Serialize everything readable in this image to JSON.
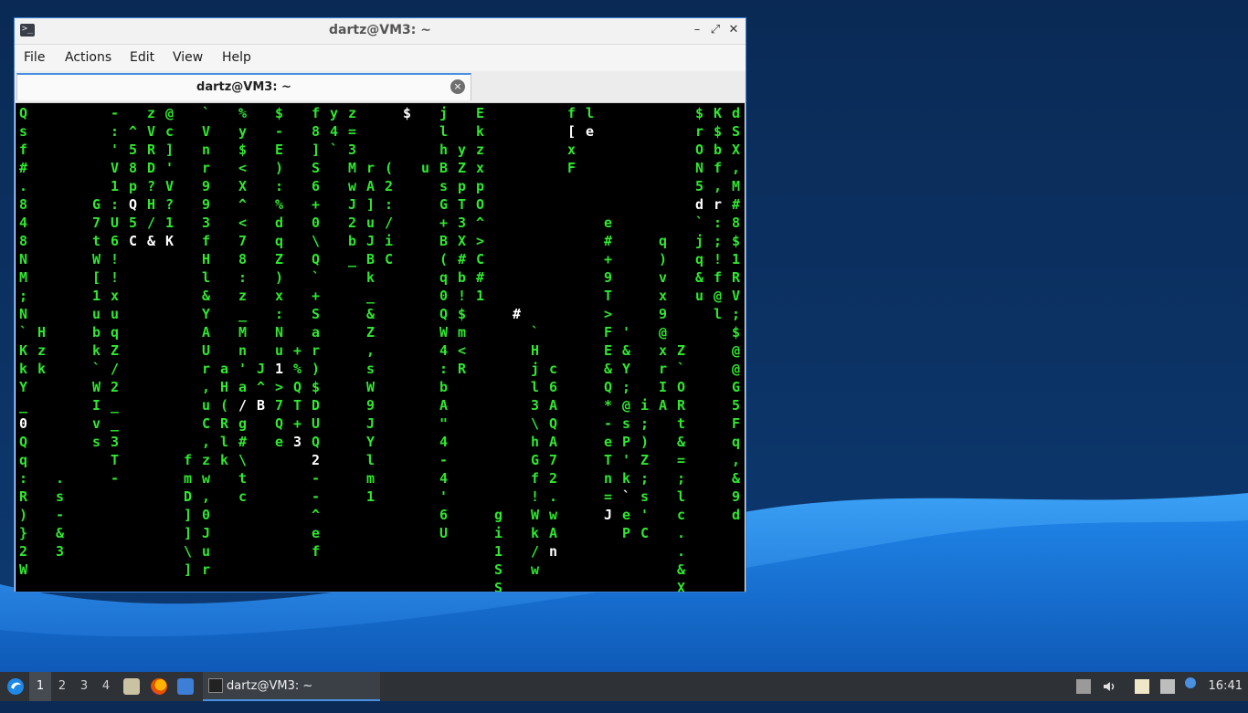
{
  "window": {
    "title": "dartz@VM3: ~",
    "minimize_glyph": "–",
    "maximize_glyph": "⤢",
    "close_glyph": "✕"
  },
  "menu": {
    "file": "File",
    "actions": "Actions",
    "edit": "Edit",
    "view": "View",
    "help": "Help"
  },
  "tab": {
    "label": "dartz@VM3: ~",
    "close_glyph": "×"
  },
  "terminal": {
    "colors": {
      "green": "#2fe82f",
      "white": "#ffffff",
      "background": "#000000"
    },
    "columns": [
      {
        "c": 0,
        "r0": 0,
        "chars": "Qsf#.848NM;N`KkY_0Qq:R)}2W",
        "hi": [
          17
        ]
      },
      {
        "c": 1,
        "r0": 12,
        "chars": "Hzk",
        "hi": []
      },
      {
        "c": 2,
        "r0": 20,
        "chars": ".s-&3",
        "hi": []
      },
      {
        "c": 4,
        "r0": 5,
        "chars": "G7tW[1ubk`WIvs",
        "hi": [
          24
        ]
      },
      {
        "c": 5,
        "r0": 0,
        "chars": "-:'V1:U6!!xuqZ/2__3T-",
        "hi": []
      },
      {
        "c": 6,
        "r0": 1,
        "chars": "^58pQ5C",
        "hi": [
          5,
          7
        ]
      },
      {
        "c": 7,
        "r0": 0,
        "chars": "zVRD?H/&",
        "hi": [
          7,
          14
        ]
      },
      {
        "c": 8,
        "r0": 0,
        "chars": "@c]'V?1K",
        "hi": [
          7
        ]
      },
      {
        "c": 9,
        "r0": 19,
        "chars": "fmD]]\\]",
        "hi": []
      },
      {
        "c": 10,
        "r0": 0,
        "chars": "`Vnr993fHl&YAUr,uC,zw,0Jur",
        "hi": []
      },
      {
        "c": 11,
        "r0": 14,
        "chars": "aH(Rlk",
        "hi": [
          20
        ]
      },
      {
        "c": 12,
        "r0": 0,
        "chars": "%y$<X^<78:z_Mn'a/g#\\tc",
        "hi": [
          16
        ]
      },
      {
        "c": 13,
        "r0": 14,
        "chars": "J^B",
        "hi": [
          16
        ]
      },
      {
        "c": 14,
        "r0": 0,
        "chars": "$-E):%dqZ)x:Nu1>7Qe",
        "hi": [
          14
        ]
      },
      {
        "c": 15,
        "r0": 13,
        "chars": "+%QT+3",
        "hi": [
          18
        ]
      },
      {
        "c": 16,
        "r0": 0,
        "chars": "f8]S6+0\\Q`+Sar)$DUQ2--^ef",
        "hi": [
          19,
          30
        ]
      },
      {
        "c": 17,
        "r0": 0,
        "chars": "y4`",
        "hi": []
      },
      {
        "c": 18,
        "r0": 0,
        "chars": "z=3MwJ2b_",
        "hi": [
          11,
          16
        ]
      },
      {
        "c": 19,
        "r0": 3,
        "chars": "rA]uJBk_&Z,sW9JYlm1",
        "hi": []
      },
      {
        "c": 20,
        "r0": 3,
        "chars": "(2:/iC",
        "hi": [
          20
        ]
      },
      {
        "c": 21,
        "r0": 0,
        "chars": "$",
        "hi": [
          0
        ]
      },
      {
        "c": 22,
        "r0": 3,
        "chars": "u",
        "hi": []
      },
      {
        "c": 23,
        "r0": 0,
        "chars": "jlhBsG+B(q0QW4:bA\"4-4'6U",
        "hi": []
      },
      {
        "c": 24,
        "r0": 2,
        "chars": "yZpT3X#b!$m<R",
        "hi": [
          15
        ]
      },
      {
        "c": 25,
        "r0": 0,
        "chars": "EkzxpO^>C#1",
        "hi": []
      },
      {
        "c": 26,
        "r0": 22,
        "chars": "gi1SSe)",
        "hi": [
          15
        ]
      },
      {
        "c": 27,
        "r0": 11,
        "chars": "#",
        "hi": [
          11
        ]
      },
      {
        "c": 28,
        "r0": 12,
        "chars": "`Hjl3\\hGf!Wk/w",
        "hi": []
      },
      {
        "c": 29,
        "r0": 14,
        "chars": "c6AQA72.wAn",
        "hi": [
          24
        ]
      },
      {
        "c": 30,
        "r0": 0,
        "chars": "f[xF",
        "hi": [
          1
        ]
      },
      {
        "c": 31,
        "r0": 0,
        "chars": "le",
        "hi": [
          1
        ]
      },
      {
        "c": 32,
        "r0": 6,
        "chars": "e#+9T>FE&Q*-eTn=J",
        "hi": [
          22
        ]
      },
      {
        "c": 33,
        "r0": 12,
        "chars": "'&Y;@sP'k`eP",
        "hi": [
          21
        ]
      },
      {
        "c": 34,
        "r0": 16,
        "chars": "i;)Z;s'C",
        "hi": []
      },
      {
        "c": 35,
        "r0": 7,
        "chars": "q)vx9@xrIA",
        "hi": []
      },
      {
        "c": 36,
        "r0": 13,
        "chars": "Z`ORt&=;lc..&XI",
        "hi": []
      },
      {
        "c": 37,
        "r0": 0,
        "chars": "$rON5d`jq&u",
        "hi": [
          5,
          12
        ]
      },
      {
        "c": 38,
        "r0": 0,
        "chars": "K$bf,r:;!f@l",
        "hi": [
          5
        ]
      },
      {
        "c": 39,
        "r0": 0,
        "chars": "dSX,M#8$1RV;$@@G5Fq,&9d",
        "hi": [
          28
        ]
      },
      {
        "c": 40,
        "r0": 5,
        "chars": "`J",
        "hi": [
          5
        ]
      },
      {
        "c": 41,
        "r0": 0,
        "chars": "RHe",
        "hi": [
          6
        ]
      },
      {
        "c": 42,
        "r0": 6,
        "chars": "UsKj;#Jy;EJpEeLh39.'",
        "hi": []
      },
      {
        "c": 43,
        "r0": 11,
        "chars": "\\xP",
        "hi": [
          17
        ]
      },
      {
        "c": 44,
        "r0": 5,
        "chars": "@k",
        "hi": []
      },
      {
        "c": 45,
        "r0": 5,
        "chars": "-j[1=mk",
        "hi": []
      },
      {
        "c": 46,
        "r0": 5,
        "chars": "$-",
        "hi": [
          8,
          9
        ]
      },
      {
        "c": 47,
        "r0": 0,
        "chars": "Hi%4J&ES>",
        "hi": []
      }
    ]
  },
  "taskbar": {
    "workspaces": [
      "1",
      "2",
      "3",
      "4"
    ],
    "active_task_label": "dartz@VM3: ~",
    "clock": "16:41"
  }
}
